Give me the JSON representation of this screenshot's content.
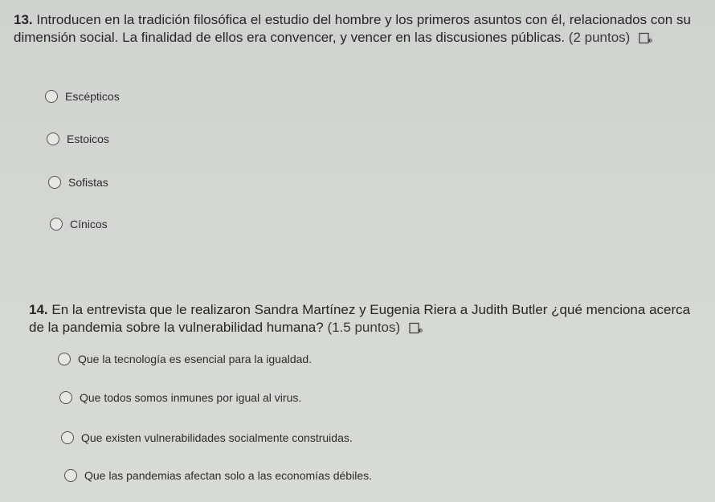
{
  "questions": [
    {
      "number": "13.",
      "text": "Introducen en la tradición filosófica el estudio del hombre y los primeros asuntos con él, relacionados con su dimensión social. La finalidad de ellos era convencer, y vencer en las discusiones públicas.",
      "points": "(2 puntos)",
      "options": [
        "Escépticos",
        "Estoicos",
        "Sofistas",
        "Cínicos"
      ]
    },
    {
      "number": "14.",
      "text": "En la entrevista que le realizaron Sandra Martínez y Eugenia Riera a Judith Butler ¿qué menciona acerca de la pandemia sobre la vulnerabilidad humana?",
      "points": "(1.5 puntos)",
      "options": [
        "Que la tecnología es esencial para la igualdad.",
        "Que todos somos inmunes por igual al virus.",
        "Que existen vulnerabilidades socialmente construidas.",
        "Que las pandemias afectan solo a las economías débiles."
      ]
    }
  ],
  "icons": {
    "read_aloud": "immersive-reader-icon"
  }
}
